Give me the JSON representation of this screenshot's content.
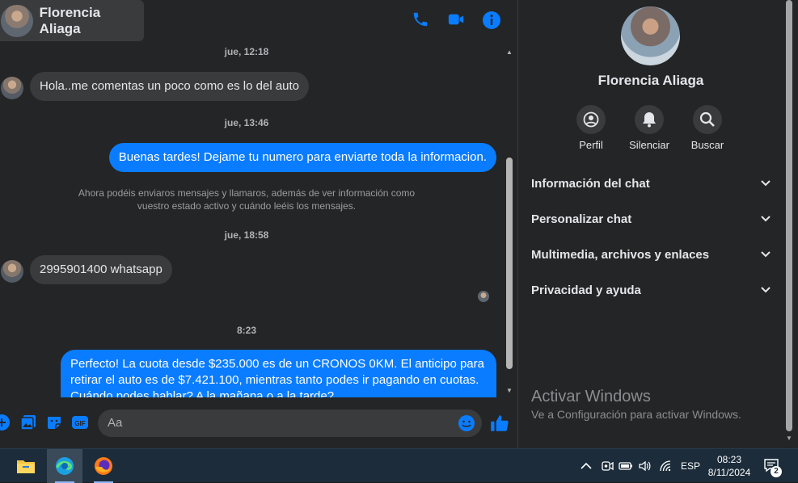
{
  "header": {
    "contact_name": "Florencia Aliaga",
    "icons": [
      "phone-icon",
      "video-icon",
      "info-icon"
    ]
  },
  "messages": {
    "timestamps": [
      "jue, 12:18",
      "jue, 13:46",
      "jue, 18:58",
      "8:23"
    ],
    "msg1": "Hola..me comentas un poco como es lo del auto",
    "msg2": "Buenas tardes! Dejame tu numero para enviarte toda la informacion.",
    "notice_line1": "Ahora podéis enviaros mensajes y llamaros, además de ver información como",
    "notice_line2": "vuestro estado activo y cuándo leéis los mensajes.",
    "msg3": "2995901400 whatsapp",
    "msg4_line1": "Perfecto! La cuota desde $235.000 es de un CRONOS 0KM. El anticipo para",
    "msg4_line2": "retirar el auto es de $7.421.100, mientras tanto podes ir pagando en cuotas.",
    "msg4_line3": "Cuándo podes hablar? A la mañana o a la tarde?"
  },
  "composer": {
    "placeholder": "Aa",
    "icons": [
      "plus-icon",
      "image-icon",
      "sticker-icon",
      "gif-icon",
      "emoji-icon",
      "like-icon"
    ]
  },
  "panel": {
    "name": "Florencia Aliaga",
    "actions": [
      {
        "label": "Perfil",
        "icon": "profile-icon"
      },
      {
        "label": "Silenciar",
        "icon": "bell-icon"
      },
      {
        "label": "Buscar",
        "icon": "search-icon"
      }
    ],
    "sections": [
      "Información del chat",
      "Personalizar chat",
      "Multimedia, archivos y enlaces",
      "Privacidad y ayuda"
    ],
    "watermark_title": "Activar Windows",
    "watermark_sub": "Ve a Configuración para activar Windows."
  },
  "taskbar": {
    "apps": [
      "file-explorer-icon",
      "edge-icon",
      "firefox-icon"
    ],
    "language": "ESP",
    "time": "08:23",
    "date": "8/11/2024",
    "notification_count": "2"
  },
  "colors": {
    "accent": "#0a7cff",
    "background": "#242526",
    "bubble_incoming": "#3a3b3c",
    "taskbar": "#1c2c3a"
  }
}
